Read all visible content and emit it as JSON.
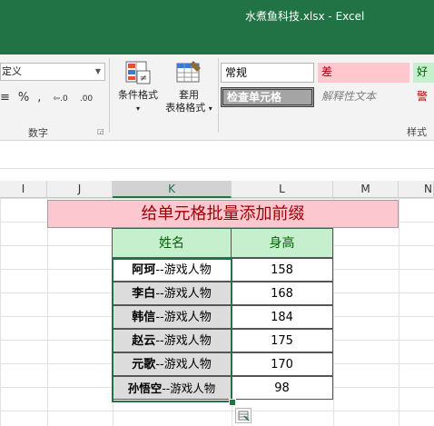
{
  "window": {
    "title": "水煮鱼科技.xlsx - Excel"
  },
  "ribbon": {
    "number_format_value": "定义",
    "number_buttons": [
      "≡",
      "%",
      ","
    ],
    "number_group_label": "数字",
    "conditional_format_label": "条件格式",
    "table_format_label_1": "套用",
    "table_format_label_2": "表格格式",
    "styles": {
      "normal": "常规",
      "bad": "差",
      "good": "好",
      "check_cell": "检查单元格",
      "explanatory": "解释性文本",
      "warning": "警"
    },
    "styles_group_label": "样式"
  },
  "sheet": {
    "columns": [
      "I",
      "J",
      "K",
      "L",
      "M",
      "N"
    ],
    "selected_column": "K",
    "banner": "给单元格批量添加前缀",
    "headers": [
      "姓名",
      "身高"
    ],
    "rows": [
      {
        "prefix": "阿珂",
        "suffix": "--游戏人物",
        "height": "158"
      },
      {
        "prefix": "李白",
        "suffix": "--游戏人物",
        "height": "168"
      },
      {
        "prefix": "韩信",
        "suffix": "--游戏人物",
        "height": "184"
      },
      {
        "prefix": "赵云",
        "suffix": "--游戏人物",
        "height": "175"
      },
      {
        "prefix": "元歌",
        "suffix": "--游戏人物",
        "height": "170"
      },
      {
        "prefix": "孙悟空",
        "suffix": "--游戏人物",
        "height": "98"
      }
    ]
  },
  "colors": {
    "excel_green": "#217346",
    "bad_fill": "#ffc7ce",
    "good_fill": "#c6efce",
    "banner_text": "#9c0006"
  }
}
